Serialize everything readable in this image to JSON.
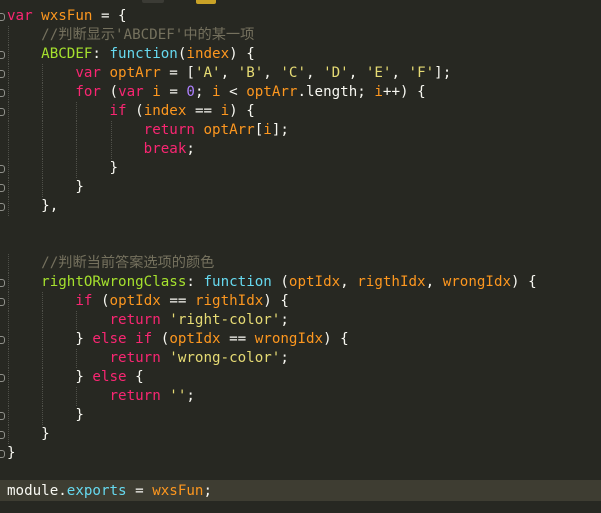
{
  "lines": [
    [
      [
        "kw",
        "var"
      ],
      [
        "pl",
        " "
      ],
      [
        "sv",
        "wxsFun"
      ],
      [
        "pl",
        " = {"
      ]
    ],
    [
      [
        "pl",
        "    "
      ],
      [
        "cm",
        "//判断显示'ABCDEF'中的某一项"
      ]
    ],
    [
      [
        "pl",
        "    "
      ],
      [
        "key",
        "ABCDEF"
      ],
      [
        "pl",
        ": "
      ],
      [
        "fn",
        "function"
      ],
      [
        "pl",
        "("
      ],
      [
        "sv",
        "index"
      ],
      [
        "pl",
        ") {"
      ]
    ],
    [
      [
        "pl",
        "        "
      ],
      [
        "kw",
        "var"
      ],
      [
        "pl",
        " "
      ],
      [
        "sv",
        "optArr"
      ],
      [
        "pl",
        " = ["
      ],
      [
        "str",
        "'A'"
      ],
      [
        "pl",
        ", "
      ],
      [
        "str",
        "'B'"
      ],
      [
        "pl",
        ", "
      ],
      [
        "str",
        "'C'"
      ],
      [
        "pl",
        ", "
      ],
      [
        "str",
        "'D'"
      ],
      [
        "pl",
        ", "
      ],
      [
        "str",
        "'E'"
      ],
      [
        "pl",
        ", "
      ],
      [
        "str",
        "'F'"
      ],
      [
        "pl",
        "];"
      ]
    ],
    [
      [
        "pl",
        "        "
      ],
      [
        "kw",
        "for"
      ],
      [
        "pl",
        " ("
      ],
      [
        "kw",
        "var"
      ],
      [
        "pl",
        " "
      ],
      [
        "sv",
        "i"
      ],
      [
        "pl",
        " = "
      ],
      [
        "num",
        "0"
      ],
      [
        "pl",
        "; "
      ],
      [
        "sv",
        "i"
      ],
      [
        "pl",
        " < "
      ],
      [
        "sv",
        "optArr"
      ],
      [
        "pl",
        "."
      ],
      [
        "pl",
        "length"
      ],
      [
        "pl",
        "; "
      ],
      [
        "sv",
        "i"
      ],
      [
        "pl",
        "++) {"
      ]
    ],
    [
      [
        "pl",
        "            "
      ],
      [
        "kw",
        "if"
      ],
      [
        "pl",
        " ("
      ],
      [
        "sv",
        "index"
      ],
      [
        "pl",
        " == "
      ],
      [
        "sv",
        "i"
      ],
      [
        "pl",
        ") {"
      ]
    ],
    [
      [
        "pl",
        "                "
      ],
      [
        "kw",
        "return"
      ],
      [
        "pl",
        " "
      ],
      [
        "sv",
        "optArr"
      ],
      [
        "pl",
        "["
      ],
      [
        "sv",
        "i"
      ],
      [
        "pl",
        "];"
      ]
    ],
    [
      [
        "pl",
        "                "
      ],
      [
        "kw",
        "break"
      ],
      [
        "pl",
        ";"
      ]
    ],
    [
      [
        "pl",
        "            }"
      ]
    ],
    [
      [
        "pl",
        "        }"
      ]
    ],
    [
      [
        "pl",
        "    },"
      ]
    ],
    [
      [
        "pl",
        ""
      ]
    ],
    [
      [
        "pl",
        ""
      ]
    ],
    [
      [
        "pl",
        "    "
      ],
      [
        "cm",
        "//判断当前答案选项的颜色"
      ]
    ],
    [
      [
        "pl",
        "    "
      ],
      [
        "key",
        "rightORwrongClass"
      ],
      [
        "pl",
        ": "
      ],
      [
        "fn",
        "function"
      ],
      [
        "pl",
        " ("
      ],
      [
        "sv",
        "optIdx"
      ],
      [
        "pl",
        ", "
      ],
      [
        "sv",
        "rigthIdx"
      ],
      [
        "pl",
        ", "
      ],
      [
        "sv",
        "wrongIdx"
      ],
      [
        "pl",
        ") {"
      ]
    ],
    [
      [
        "pl",
        "        "
      ],
      [
        "kw",
        "if"
      ],
      [
        "pl",
        " ("
      ],
      [
        "sv",
        "optIdx"
      ],
      [
        "pl",
        " == "
      ],
      [
        "sv",
        "rigthIdx"
      ],
      [
        "pl",
        ") {"
      ]
    ],
    [
      [
        "pl",
        "            "
      ],
      [
        "kw",
        "return"
      ],
      [
        "pl",
        " "
      ],
      [
        "str",
        "'right-color'"
      ],
      [
        "pl",
        ";"
      ]
    ],
    [
      [
        "pl",
        "        } "
      ],
      [
        "kw",
        "else"
      ],
      [
        "pl",
        " "
      ],
      [
        "kw",
        "if"
      ],
      [
        "pl",
        " ("
      ],
      [
        "sv",
        "optIdx"
      ],
      [
        "pl",
        " == "
      ],
      [
        "sv",
        "wrongIdx"
      ],
      [
        "pl",
        ") {"
      ]
    ],
    [
      [
        "pl",
        "            "
      ],
      [
        "kw",
        "return"
      ],
      [
        "pl",
        " "
      ],
      [
        "str",
        "'wrong-color'"
      ],
      [
        "pl",
        ";"
      ]
    ],
    [
      [
        "pl",
        "        } "
      ],
      [
        "kw",
        "else"
      ],
      [
        "pl",
        " {"
      ]
    ],
    [
      [
        "pl",
        "            "
      ],
      [
        "kw",
        "return"
      ],
      [
        "pl",
        " "
      ],
      [
        "str",
        "''"
      ],
      [
        "pl",
        ";"
      ]
    ],
    [
      [
        "pl",
        "        }"
      ]
    ],
    [
      [
        "pl",
        "    }"
      ]
    ],
    [
      [
        "pl",
        "}"
      ]
    ],
    [
      [
        "pl",
        ""
      ]
    ],
    [
      [
        "pl",
        "module"
      ],
      [
        "pl",
        "."
      ],
      [
        "blue",
        "exports"
      ],
      [
        "pl",
        " = "
      ],
      [
        "sv",
        "wxsFun"
      ],
      [
        "pl",
        ";"
      ]
    ]
  ]
}
